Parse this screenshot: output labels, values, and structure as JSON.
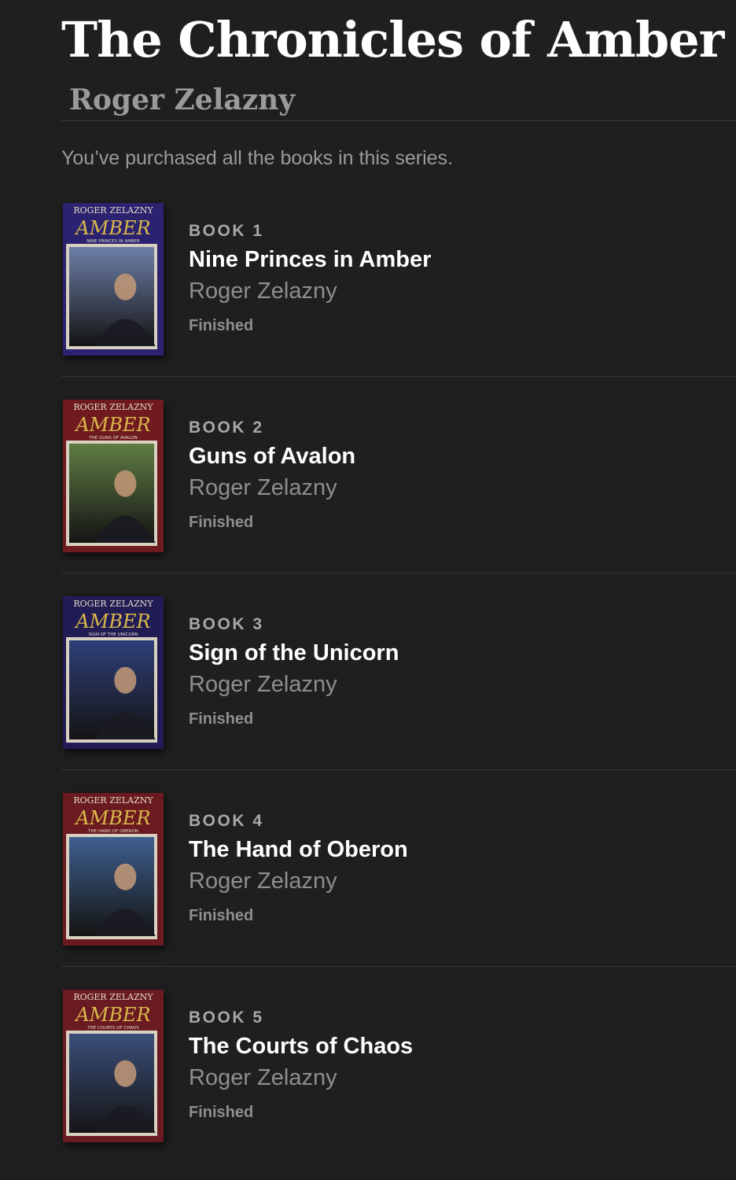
{
  "series": {
    "title": "The Chronicles of Amber",
    "author": "Roger Zelazny",
    "purchase_note": "You’ve purchased all the books in this series."
  },
  "books": [
    {
      "number_label": "BOOK 1",
      "title": "Nine Princes in Amber",
      "author": "Roger Zelazny",
      "status": "Finished",
      "cover": {
        "author_text": "ROGER ZELAZNY",
        "series_text": "AMBER",
        "book_text": "NINE PRINCES IN AMBER",
        "frame_color": "#2b2270",
        "scene_color": "#6d7fa8",
        "accent_color": "#d9b84a"
      }
    },
    {
      "number_label": "BOOK 2",
      "title": "Guns of Avalon",
      "author": "Roger Zelazny",
      "status": "Finished",
      "cover": {
        "author_text": "ROGER ZELAZNY",
        "series_text": "AMBER",
        "book_text": "THE GUNS OF AVALON",
        "frame_color": "#6e1a1f",
        "scene_color": "#5f7d44",
        "accent_color": "#d9b84a"
      }
    },
    {
      "number_label": "BOOK 3",
      "title": "Sign of the Unicorn",
      "author": "Roger Zelazny",
      "status": "Finished",
      "cover": {
        "author_text": "ROGER ZELAZNY",
        "series_text": "AMBER",
        "book_text": "SIGN OF THE UNICORN",
        "frame_color": "#221c55",
        "scene_color": "#2f3f7a",
        "accent_color": "#d9b84a"
      }
    },
    {
      "number_label": "BOOK 4",
      "title": "The Hand of Oberon",
      "author": "Roger Zelazny",
      "status": "Finished",
      "cover": {
        "author_text": "ROGER ZELAZNY",
        "series_text": "AMBER",
        "book_text": "THE HAND OF OBERON",
        "frame_color": "#6a1a20",
        "scene_color": "#3f5f8f",
        "accent_color": "#d9b84a"
      }
    },
    {
      "number_label": "BOOK 5",
      "title": "The Courts of Chaos",
      "author": "Roger Zelazny",
      "status": "Finished",
      "cover": {
        "author_text": "ROGER ZELAZNY",
        "series_text": "AMBER",
        "book_text": "THE COURTS OF CHAOS",
        "frame_color": "#6a1a22",
        "scene_color": "#3b4f7a",
        "accent_color": "#d9b84a"
      }
    }
  ],
  "theme": {
    "background": "#1f1f1f",
    "text_primary": "#ffffff",
    "text_secondary": "#8e8e8e"
  }
}
